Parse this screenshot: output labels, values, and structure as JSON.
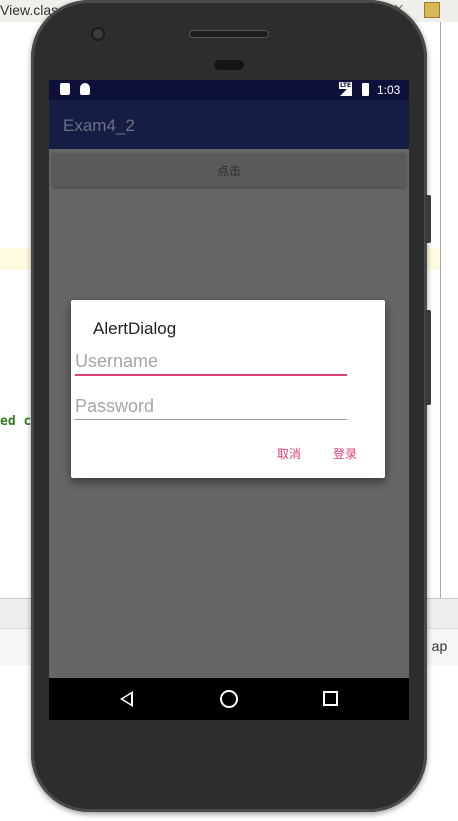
{
  "ide": {
    "tab_label": "View.class",
    "tab_close": "×",
    "code_fragment": "ed c",
    "status_fragment": "d ap"
  },
  "statusbar": {
    "time": "1:03",
    "network": "LTE",
    "icons": [
      "sd-card-icon",
      "android-icon",
      "signal-icon",
      "battery-icon"
    ]
  },
  "appbar": {
    "title": "Exam4_2"
  },
  "main": {
    "click_button_label": "点击"
  },
  "dialog": {
    "title": "AlertDialog",
    "username_placeholder": "Username",
    "password_placeholder": "Password",
    "cancel_label": "取消",
    "login_label": "登录"
  },
  "navbar": {
    "icons": [
      "back-icon",
      "home-icon",
      "recents-icon"
    ]
  },
  "colors": {
    "accent": "#e2407a",
    "appbar": "#151d45",
    "statusbar": "#0d103b",
    "scrim": "#666666"
  }
}
